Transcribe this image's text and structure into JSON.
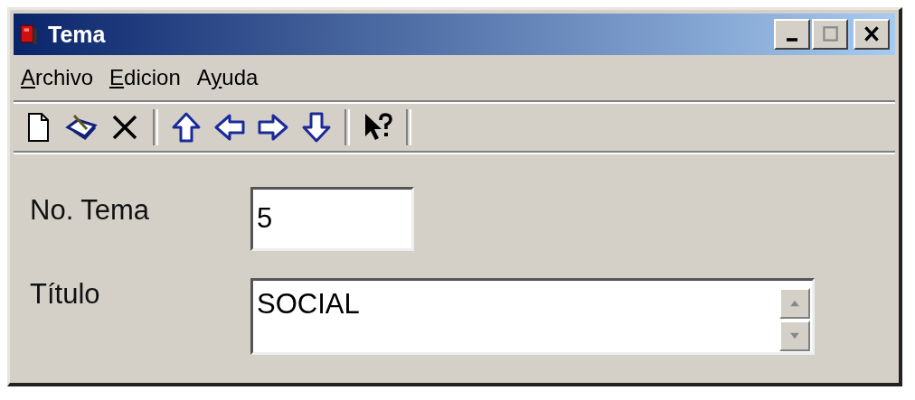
{
  "window": {
    "title": "Tema"
  },
  "menu": [
    {
      "key": "A",
      "rest": "rchivo"
    },
    {
      "key": "E",
      "rest": "dicion"
    },
    {
      "lead": "A",
      "key": "y",
      "rest": "uda"
    }
  ],
  "toolbar": [
    {
      "kind": "new"
    },
    {
      "kind": "edit"
    },
    {
      "kind": "delete"
    },
    {
      "kind": "separator"
    },
    {
      "kind": "up"
    },
    {
      "kind": "left"
    },
    {
      "kind": "right"
    },
    {
      "kind": "down"
    },
    {
      "kind": "separator"
    },
    {
      "kind": "help"
    },
    {
      "kind": "separator"
    }
  ],
  "fields": [
    {
      "label": "No. Tema",
      "value": "5",
      "kind": "text"
    },
    {
      "label": "Título",
      "value": "SOCIAL",
      "kind": "memo"
    }
  ]
}
